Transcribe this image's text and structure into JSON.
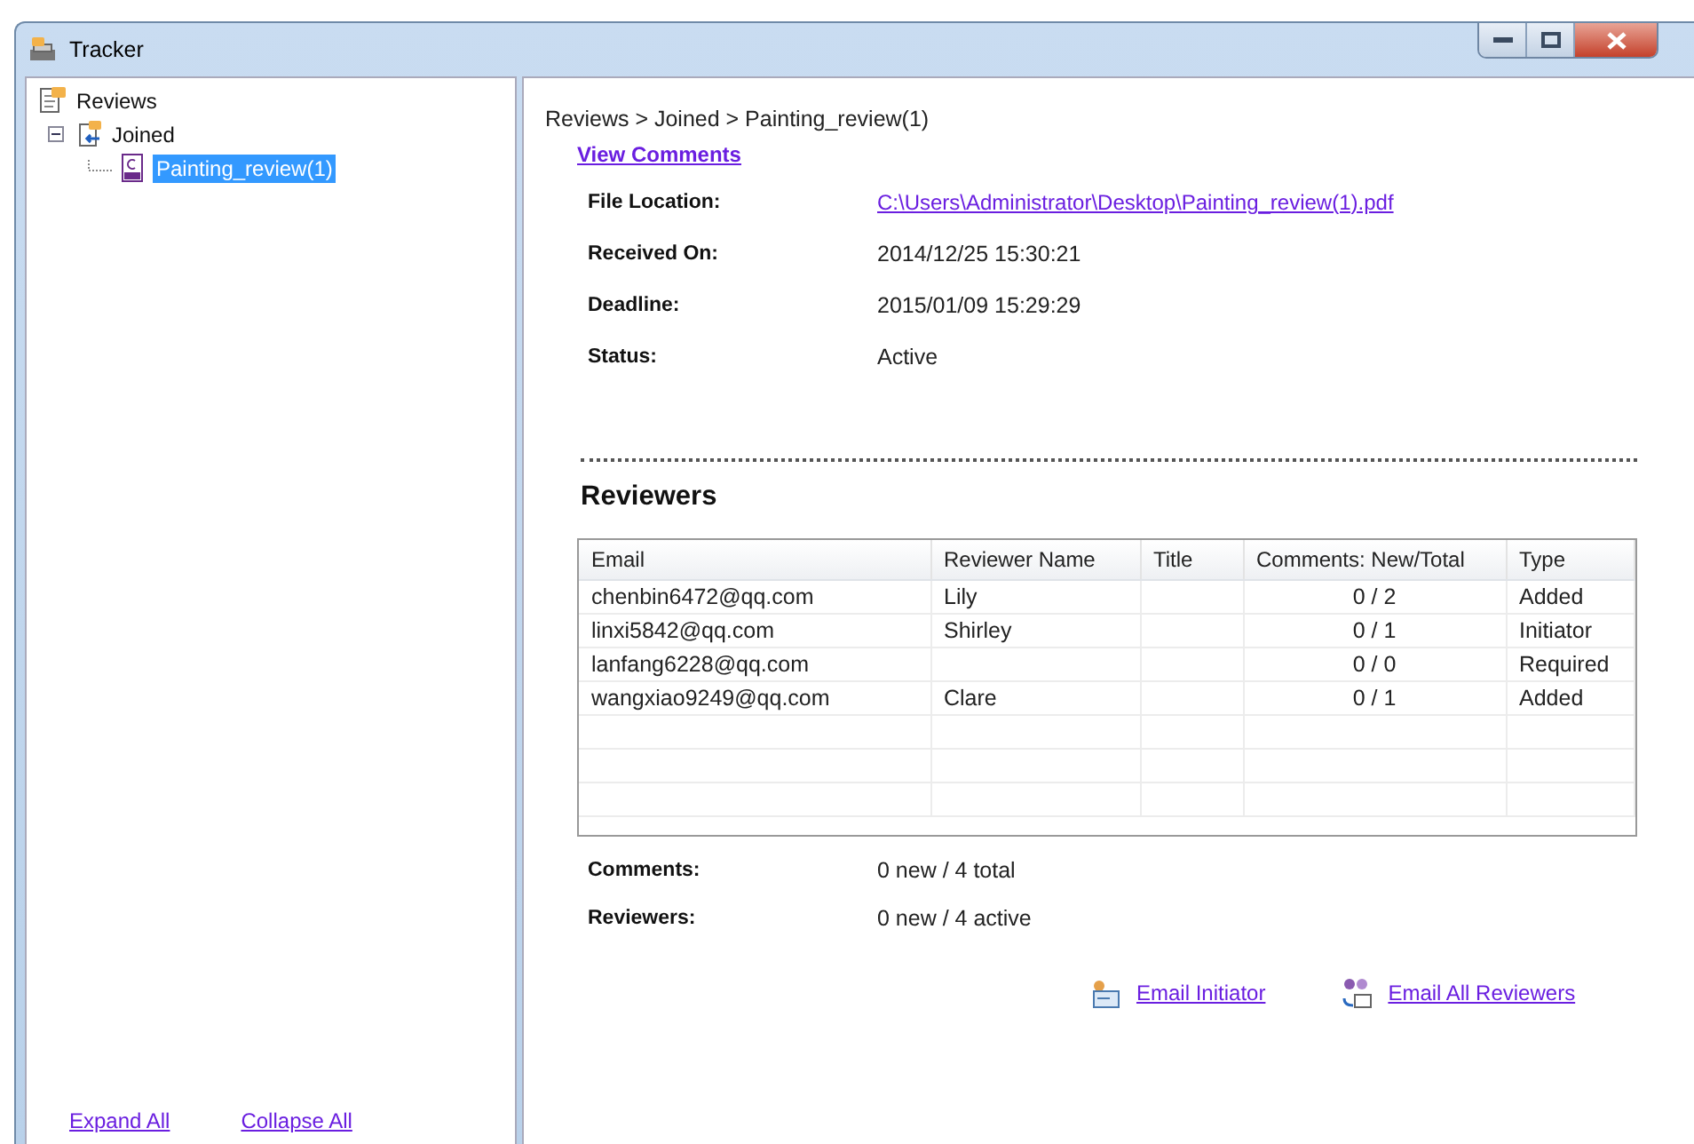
{
  "window": {
    "title": "Tracker"
  },
  "tree": [
    {
      "label": "Reviews",
      "kind": "reviews",
      "selected": false,
      "children": [
        {
          "label": "Joined",
          "kind": "joined",
          "selected": false,
          "expanded": true,
          "children": [
            {
              "label": "Painting_review(1)",
              "kind": "pdf",
              "selected": true
            }
          ]
        }
      ]
    }
  ],
  "tree_links": [
    "Expand All",
    "Collapse All"
  ],
  "breadcrumb": "Reviews > Joined > Painting_review(1)",
  "view_comments": "View Comments",
  "details": [
    {
      "label": "File Location:",
      "value": "C:\\Users\\Administrator\\Desktop\\Painting_review(1).pdf",
      "kind": "link"
    },
    {
      "label": "Received On:",
      "value": "2014/12/25 15:30:21",
      "kind": "text"
    },
    {
      "label": "Deadline:",
      "value": "2015/01/09 15:29:29",
      "kind": "text"
    },
    {
      "label": "Status:",
      "value": "Active",
      "kind": "text"
    }
  ],
  "reviewers": {
    "heading": "Reviewers",
    "columns": [
      "Email",
      "Reviewer Name",
      "Title",
      "Comments: New/Total",
      "Type"
    ],
    "rows": [
      [
        "chenbin6472@qq.com",
        "Lily",
        "",
        "0 / 2",
        "Added"
      ],
      [
        "linxi5842@qq.com",
        "Shirley",
        "",
        "0 / 1",
        "Initiator"
      ],
      [
        "lanfang6228@qq.com",
        "",
        "",
        "0 / 0",
        "Required"
      ],
      [
        "wangxiao9249@qq.com",
        "Clare",
        "",
        "0 / 1",
        "Added"
      ]
    ]
  },
  "summary": [
    {
      "label": "Comments:",
      "value": "0 new / 4 total"
    },
    {
      "label": "Reviewers:",
      "value": "0 new / 4 active"
    }
  ],
  "actions": [
    {
      "label": "Email Initiator",
      "kind": "initiator"
    },
    {
      "label": "Email All Reviewers",
      "kind": "all"
    }
  ]
}
